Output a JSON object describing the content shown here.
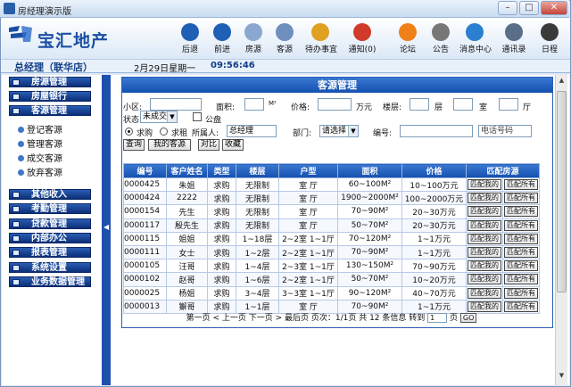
{
  "window": {
    "title": "房经理演示版",
    "min": "–",
    "max": "□",
    "close": "✕"
  },
  "brand": {
    "name": "宝汇地产"
  },
  "toolbar": [
    {
      "label": "后退",
      "icon": "back-arrow-icon",
      "color": "#1f5fb5"
    },
    {
      "label": "前进",
      "icon": "forward-arrow-icon",
      "color": "#1f5fb5"
    },
    {
      "label": "房源",
      "icon": "house-icon",
      "color": "#8aa8cf"
    },
    {
      "label": "客源",
      "icon": "customers-icon",
      "color": "#6f8fbf"
    },
    {
      "label": "待办事宜",
      "icon": "home-todo-icon",
      "color": "#e0a020"
    },
    {
      "label": "通知(0)",
      "icon": "notice-icon",
      "color": "#d03a2a"
    },
    {
      "label": "论坛",
      "icon": "rss-icon",
      "color": "#f0801a"
    },
    {
      "label": "公告",
      "icon": "announce-icon",
      "color": "#777777"
    },
    {
      "label": "消息中心",
      "icon": "info-icon",
      "color": "#2a7fd0"
    },
    {
      "label": "通讯录",
      "icon": "phonebook-icon",
      "color": "#5a6e88"
    },
    {
      "label": "日程",
      "icon": "clock-icon",
      "color": "#3a3a3a"
    }
  ],
  "status": {
    "user": "总经理（联华店）",
    "date": "2月29日星期一",
    "time": "09:56:46"
  },
  "sidebar": {
    "groups": [
      {
        "label": "房源管理"
      },
      {
        "label": "房屋银行"
      },
      {
        "label": "客源管理"
      }
    ],
    "subitems": [
      "登记客源",
      "管理客源",
      "成交客源",
      "放弃客源"
    ],
    "groups2": [
      {
        "label": "其他收入"
      },
      {
        "label": "考勤管理"
      },
      {
        "label": "贷款管理"
      },
      {
        "label": "内部办公"
      },
      {
        "label": "报表管理"
      },
      {
        "label": "系统设置"
      },
      {
        "label": "业务数据管理"
      }
    ]
  },
  "panel": {
    "title": "客源管理"
  },
  "filters": {
    "district_label": "小区:",
    "area_label": "面积:",
    "area_unit": "M²",
    "price_label": "价格:",
    "price_unit": "万元",
    "floor_label": "楼层:",
    "floor_unit": "层",
    "room_unit": "室",
    "hall_unit": "厅",
    "status_label": "状态:",
    "status_value": "未成交",
    "public_label": "公盘",
    "buy_label": "求购",
    "rent_label": "求租",
    "owner_label": "所属人:",
    "owner_value": "总经理",
    "dept_label": "部门:",
    "dept_value": "请选择",
    "code_label": "编号:",
    "phone_placeholder": "电话号码",
    "btn_query": "查询",
    "btn_mine": "我的客源",
    "btn_compare": "对比",
    "btn_fav": "收藏"
  },
  "table": {
    "headers": [
      "编号",
      "客户姓名",
      "类型",
      "楼层",
      "户型",
      "面积",
      "价格",
      "匹配房源"
    ],
    "match_mine": "匹配我的",
    "match_all": "匹配所有",
    "rows": [
      [
        "0000425",
        "朱姐",
        "求购",
        "无限制",
        "室 厅",
        "60~100M²",
        "10~100万元"
      ],
      [
        "0000424",
        "2222",
        "求购",
        "无限制",
        "室 厅",
        "1900~2000M²",
        "100~2000万元"
      ],
      [
        "0000154",
        "先生",
        "求购",
        "无限制",
        "室 厅",
        "70~90M²",
        "20~30万元"
      ],
      [
        "0000117",
        "殷先生",
        "求购",
        "无限制",
        "室 厅",
        "50~70M²",
        "20~30万元"
      ],
      [
        "0000115",
        "姐姐",
        "求购",
        "1~18层",
        "2~2室 1~1厅",
        "70~120M²",
        "1~1万元"
      ],
      [
        "0000111",
        "女士",
        "求购",
        "1~2层",
        "2~2室 1~1厅",
        "70~90M²",
        "1~1万元"
      ],
      [
        "0000105",
        "汪哥",
        "求购",
        "1~4层",
        "2~3室 1~1厅",
        "130~150M²",
        "70~90万元"
      ],
      [
        "0000102",
        "赵哥",
        "求购",
        "1~6层",
        "2~2室 1~1厅",
        "50~70M²",
        "10~20万元"
      ],
      [
        "0000025",
        "杨姐",
        "求购",
        "3~4层",
        "3~3室 1~1厅",
        "90~120M²",
        "40~70万元"
      ],
      [
        "0000013",
        "獬哥",
        "求购",
        "1~1层",
        "室 厅",
        "70~90M²",
        "1~1万元"
      ]
    ]
  },
  "pager": {
    "text": "第一页 < 上一页 下一页 > 最后页 页次：1/1页 共 12 条信息 转到",
    "page_value": "1",
    "page_unit": "页",
    "go": "GO"
  }
}
